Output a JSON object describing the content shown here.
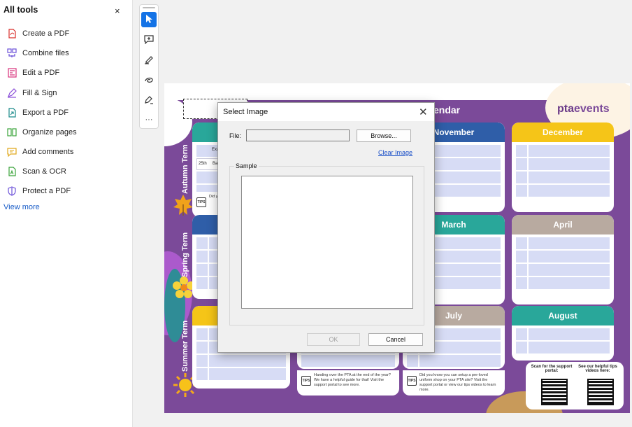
{
  "tools_panel": {
    "title": "All tools",
    "close_icon": "×",
    "items": [
      {
        "label": "Create a PDF",
        "icon": "create-pdf-icon",
        "color": "#d9302c"
      },
      {
        "label": "Combine files",
        "icon": "combine-files-icon",
        "color": "#6a4fd8"
      },
      {
        "label": "Edit a PDF",
        "icon": "edit-pdf-icon",
        "color": "#d8307a"
      },
      {
        "label": "Fill & Sign",
        "icon": "fill-sign-icon",
        "color": "#8a4fd8"
      },
      {
        "label": "Export a PDF",
        "icon": "export-pdf-icon",
        "color": "#1a8a8a"
      },
      {
        "label": "Organize pages",
        "icon": "organize-pages-icon",
        "color": "#3aa33a"
      },
      {
        "label": "Add comments",
        "icon": "add-comments-icon",
        "color": "#e0a81a"
      },
      {
        "label": "Scan & OCR",
        "icon": "scan-ocr-icon",
        "color": "#3aa33a"
      },
      {
        "label": "Protect a PDF",
        "icon": "protect-pdf-icon",
        "color": "#6a4fd8"
      }
    ],
    "view_more": "View more"
  },
  "vertical_toolbar": {
    "tools": [
      {
        "icon": "select-cursor-icon",
        "active": true
      },
      {
        "icon": "add-comment-icon",
        "active": false
      },
      {
        "icon": "highlight-pen-icon",
        "active": false
      },
      {
        "icon": "draw-freeform-icon",
        "active": false
      },
      {
        "icon": "fill-sign-pen-icon",
        "active": false
      },
      {
        "icon": "more-tools-icon",
        "label": "···",
        "active": false
      }
    ],
    "accent": "#1473e6"
  },
  "document": {
    "calendar_title": "endar",
    "logo_prefix": "pta",
    "logo_suffix": "events",
    "terms": [
      "Autumn Term",
      "Spring Term",
      "Summer Term"
    ],
    "months": [
      {
        "name": "November",
        "color": "#2f5ea8"
      },
      {
        "name": "December",
        "color": "#f5c518"
      },
      {
        "name": "March",
        "color": "#29a79a"
      },
      {
        "name": "April",
        "color": "#b8aaa0"
      },
      {
        "name": "July",
        "color": "#b8aaa0"
      },
      {
        "name": "August",
        "color": "#29a79a"
      }
    ],
    "row_snippets": [
      "Exa",
      "25th",
      "Bac"
    ],
    "tips_tag": "TIPS",
    "tips": [
      "Did you ... from ... to see",
      "Handing over the PTA at the end of the year? We have a helpful guide for that! Visit the support portal to see more.",
      "Did you know you can setup a pre-loved uniform shop on your PTA site? Visit the support portal or view our tips videos to learn more."
    ],
    "scan_portal": "Scan for the support portal:",
    "helpful_tips": "See our helpful tips videos here:",
    "page_bg": "#7b4a99"
  },
  "dialog": {
    "title": "Select Image",
    "close_icon": "✕",
    "file_label": "File:",
    "file_value": "",
    "browse_label": "Browse...",
    "clear_label": "Clear Image",
    "sample_label": "Sample",
    "ok_label": "OK",
    "cancel_label": "Cancel"
  }
}
